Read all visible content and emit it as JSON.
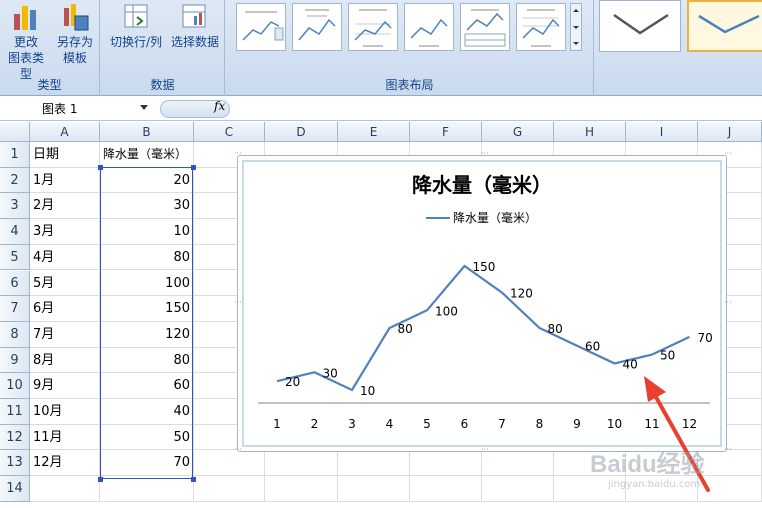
{
  "ribbon": {
    "groups": [
      {
        "label": "类型",
        "buttons": [
          {
            "label": "更改\n图表类型",
            "icon": "change-chart-type-icon"
          },
          {
            "label": "另存为\n模板",
            "icon": "save-as-template-icon"
          }
        ]
      },
      {
        "label": "数据",
        "buttons": [
          {
            "label": "切换行/列",
            "icon": "switch-row-column-icon"
          },
          {
            "label": "选择数据",
            "icon": "select-data-icon"
          }
        ]
      },
      {
        "label": "图表布局",
        "layouts": 6
      },
      {
        "label": "",
        "styles": 2
      }
    ]
  },
  "formula_bar": {
    "name_box": "图表 1",
    "fx_label": "fx"
  },
  "sheet": {
    "columns": [
      "A",
      "B",
      "C",
      "D",
      "E",
      "F",
      "G",
      "H",
      "I",
      "J"
    ],
    "rows": [
      "1",
      "2",
      "3",
      "4",
      "5",
      "6",
      "7",
      "8",
      "9",
      "10",
      "11",
      "12",
      "13",
      "14"
    ],
    "header_row": {
      "a": "日期",
      "b": "降水量（毫米）"
    },
    "data": [
      {
        "month": "1月",
        "value": "20"
      },
      {
        "month": "2月",
        "value": "30"
      },
      {
        "month": "3月",
        "value": "10"
      },
      {
        "month": "4月",
        "value": "80"
      },
      {
        "month": "5月",
        "value": "100"
      },
      {
        "month": "6月",
        "value": "150"
      },
      {
        "month": "7月",
        "value": "120"
      },
      {
        "month": "8月",
        "value": "80"
      },
      {
        "month": "9月",
        "value": "60"
      },
      {
        "month": "10月",
        "value": "40"
      },
      {
        "month": "11月",
        "value": "50"
      },
      {
        "month": "12月",
        "value": "70"
      }
    ]
  },
  "chart_data": {
    "type": "line",
    "title": "降水量（毫米）",
    "categories": [
      "1",
      "2",
      "3",
      "4",
      "5",
      "6",
      "7",
      "8",
      "9",
      "10",
      "11",
      "12"
    ],
    "series": [
      {
        "name": "降水量（毫米）",
        "values": [
          20,
          30,
          10,
          80,
          100,
          150,
          120,
          80,
          60,
          40,
          50,
          70
        ],
        "color": "#4f81bd"
      }
    ],
    "legend": "top",
    "ylim": [
      0,
      180
    ],
    "grid": false
  },
  "annotation": {
    "arrow_color": "#e8402e"
  },
  "watermark": {
    "text": "Baidu经验",
    "sub": "jingyan.baidu.com"
  },
  "colors": {
    "ribbon_text": "#15428b",
    "series_line": "#4f81bd",
    "selection": "#2f56c0"
  }
}
